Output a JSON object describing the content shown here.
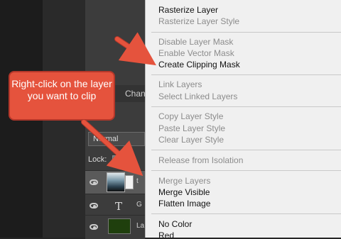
{
  "layers_panel": {
    "tab_label": "Chann",
    "blend_mode": "Normal",
    "lock_label": "Lock:",
    "layers": [
      {
        "name": "t",
        "type": "image"
      },
      {
        "name": "G",
        "type": "text"
      },
      {
        "name": "La",
        "type": "fill"
      }
    ]
  },
  "callout": {
    "text": "Right-click on the layer you want to clip"
  },
  "context_menu": {
    "items": [
      {
        "label": "Rasterize Layer",
        "enabled": true
      },
      {
        "label": "Rasterize Layer Style",
        "enabled": false
      },
      {
        "label": "Disable Layer Mask",
        "enabled": false
      },
      {
        "label": "Enable Vector Mask",
        "enabled": false
      },
      {
        "label": "Create Clipping Mask",
        "enabled": true
      },
      {
        "label": "Link Layers",
        "enabled": false
      },
      {
        "label": "Select Linked Layers",
        "enabled": false
      },
      {
        "label": "Copy Layer Style",
        "enabled": false
      },
      {
        "label": "Paste Layer Style",
        "enabled": false
      },
      {
        "label": "Clear Layer Style",
        "enabled": false
      },
      {
        "label": "Release from Isolation",
        "enabled": false
      },
      {
        "label": "Merge Layers",
        "enabled": false
      },
      {
        "label": "Merge Visible",
        "enabled": true
      },
      {
        "label": "Flatten Image",
        "enabled": true
      },
      {
        "label": "No Color",
        "enabled": true
      },
      {
        "label": "Red",
        "enabled": true
      }
    ]
  },
  "colors": {
    "callout": "#e5533d",
    "menu_bg": "#f0f0f0",
    "panel_bg": "#3c3c3c"
  }
}
